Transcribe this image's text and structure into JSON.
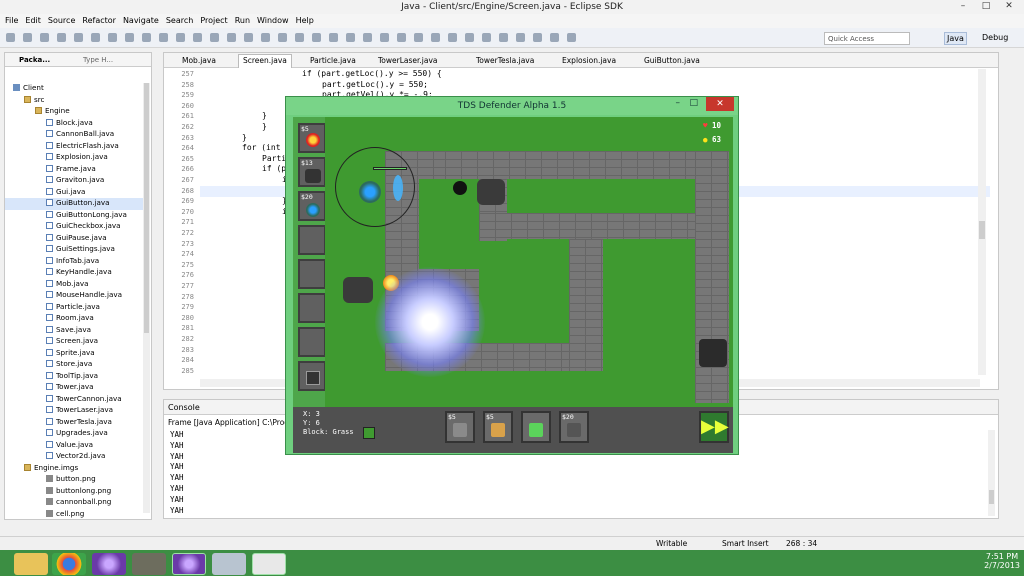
{
  "window": {
    "title": "Java - Client/src/Engine/Screen.java - Eclipse SDK"
  },
  "menu": [
    "File",
    "Edit",
    "Source",
    "Refactor",
    "Navigate",
    "Search",
    "Project",
    "Run",
    "Window",
    "Help"
  ],
  "quick_access": "Quick Access",
  "perspectives": [
    "Java",
    "Debug"
  ],
  "package_explorer": {
    "tabs": [
      "Packa...",
      "Type H..."
    ],
    "items": [
      {
        "label": "Client",
        "depth": 0,
        "icon": "project-icon"
      },
      {
        "label": "src",
        "depth": 1,
        "icon": "folder-icon"
      },
      {
        "label": "Engine",
        "depth": 2,
        "icon": "package-icon"
      },
      {
        "label": "Block.java",
        "depth": 3,
        "icon": "java-file-icon"
      },
      {
        "label": "CannonBall.java",
        "depth": 3,
        "icon": "java-file-icon"
      },
      {
        "label": "ElectricFlash.java",
        "depth": 3,
        "icon": "java-file-icon"
      },
      {
        "label": "Explosion.java",
        "depth": 3,
        "icon": "java-file-icon"
      },
      {
        "label": "Frame.java",
        "depth": 3,
        "icon": "java-file-icon"
      },
      {
        "label": "Graviton.java",
        "depth": 3,
        "icon": "java-file-icon"
      },
      {
        "label": "Gui.java",
        "depth": 3,
        "icon": "java-file-icon"
      },
      {
        "label": "GuiButton.java",
        "depth": 3,
        "icon": "java-file-icon"
      },
      {
        "label": "GuiButtonLong.java",
        "depth": 3,
        "icon": "java-file-icon"
      },
      {
        "label": "GuiCheckbox.java",
        "depth": 3,
        "icon": "java-file-icon"
      },
      {
        "label": "GuiPause.java",
        "depth": 3,
        "icon": "java-file-icon"
      },
      {
        "label": "GuiSettings.java",
        "depth": 3,
        "icon": "java-file-icon"
      },
      {
        "label": "InfoTab.java",
        "depth": 3,
        "icon": "java-file-icon"
      },
      {
        "label": "KeyHandle.java",
        "depth": 3,
        "icon": "java-file-icon"
      },
      {
        "label": "Mob.java",
        "depth": 3,
        "icon": "java-file-icon"
      },
      {
        "label": "MouseHandle.java",
        "depth": 3,
        "icon": "java-file-icon"
      },
      {
        "label": "Particle.java",
        "depth": 3,
        "icon": "java-file-icon"
      },
      {
        "label": "Room.java",
        "depth": 3,
        "icon": "java-file-icon"
      },
      {
        "label": "Save.java",
        "depth": 3,
        "icon": "java-file-icon"
      },
      {
        "label": "Screen.java",
        "depth": 3,
        "icon": "java-file-icon"
      },
      {
        "label": "Sprite.java",
        "depth": 3,
        "icon": "java-file-icon"
      },
      {
        "label": "Store.java",
        "depth": 3,
        "icon": "java-file-icon"
      },
      {
        "label": "ToolTip.java",
        "depth": 3,
        "icon": "java-file-icon"
      },
      {
        "label": "Tower.java",
        "depth": 3,
        "icon": "java-file-icon"
      },
      {
        "label": "TowerCannon.java",
        "depth": 3,
        "icon": "java-file-icon"
      },
      {
        "label": "TowerLaser.java",
        "depth": 3,
        "icon": "java-file-icon"
      },
      {
        "label": "TowerTesla.java",
        "depth": 3,
        "icon": "java-file-icon"
      },
      {
        "label": "Upgrades.java",
        "depth": 3,
        "icon": "java-file-icon"
      },
      {
        "label": "Value.java",
        "depth": 3,
        "icon": "java-file-icon"
      },
      {
        "label": "Vector2d.java",
        "depth": 3,
        "icon": "java-file-icon"
      },
      {
        "label": "Engine.imgs",
        "depth": 1,
        "icon": "image-folder-icon"
      },
      {
        "label": "button.png",
        "depth": 3,
        "icon": "image-file-icon"
      },
      {
        "label": "buttonlong.png",
        "depth": 3,
        "icon": "image-file-icon"
      },
      {
        "label": "cannonball.png",
        "depth": 3,
        "icon": "image-file-icon"
      },
      {
        "label": "cell.png",
        "depth": 3,
        "icon": "image-file-icon"
      }
    ]
  },
  "editor": {
    "tabs": [
      "Mob.java",
      "Screen.java",
      "Particle.java",
      "TowerLaser.java",
      "TowerTesla.java",
      "Explosion.java",
      "GuiButton.java"
    ],
    "active_tab": "Screen.java",
    "line_numbers": [
      "257",
      "258",
      "259",
      "260",
      "261",
      "262",
      "263",
      "264",
      "265",
      "266",
      "267",
      "268",
      "269",
      "270",
      "271",
      "272",
      "273",
      "274",
      "275",
      "276",
      "277",
      "278",
      "279",
      "280",
      "281",
      "282",
      "283",
      "284",
      "285"
    ],
    "code": [
      {
        "line": "257",
        "text": "if (part.getLoc().y >= 550) {"
      },
      {
        "line": "258",
        "text": "part.getLoc().y = 550;"
      },
      {
        "line": "259",
        "text": "part.getVel().y *= -.9;"
      },
      {
        "line": "261",
        "text": "}"
      },
      {
        "line": "262",
        "text": "}"
      },
      {
        "line": "263",
        "text": "}"
      },
      {
        "line": "264",
        "text": "for (int"
      },
      {
        "line": "265",
        "text": "Parti"
      },
      {
        "line": "266",
        "text": "if (p"
      },
      {
        "line": "267",
        "text": "i"
      },
      {
        "line": "269",
        "text": "}"
      },
      {
        "line": "270",
        "text": "i"
      }
    ]
  },
  "console": {
    "tab": "Console",
    "subtitle": "Frame [Java Application] C:\\Progra",
    "lines": [
      "YAH",
      "YAH",
      "YAH",
      "YAH",
      "YAH",
      "YAH",
      "YAH",
      "YAH"
    ]
  },
  "status": {
    "writable": "Writable",
    "insert": "Smart Insert",
    "position": "268 : 34"
  },
  "taskbar": {
    "time": "7:51 PM",
    "date": "2/7/2013"
  },
  "game": {
    "title": "TDS Defender Alpha 1.5",
    "lives": "10",
    "coins": "63",
    "shop_prices": [
      "$5",
      "$13",
      "$20"
    ],
    "info": {
      "x": "X: 3",
      "y": "Y: 6",
      "block": "Block: Grass"
    },
    "bottom_prices": [
      "$5",
      "$5",
      "",
      "$20"
    ]
  }
}
